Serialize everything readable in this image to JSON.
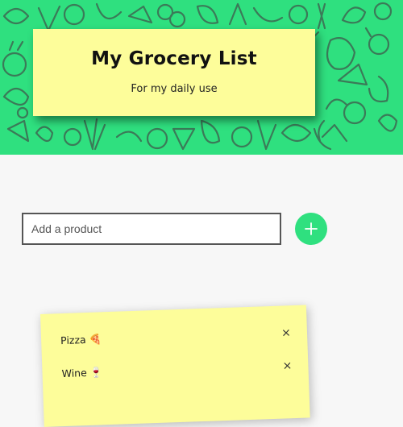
{
  "header": {
    "title": "My Grocery List",
    "subtitle": "For my daily use"
  },
  "colors": {
    "accent": "#2fe07f",
    "note": "#fdfd9a"
  },
  "add_form": {
    "placeholder": "Add a product",
    "value": "",
    "button_icon": "plus-icon"
  },
  "items": [
    {
      "label": "Pizza 🍕",
      "remove": "×"
    },
    {
      "label": "Wine 🍷",
      "remove": "×"
    }
  ]
}
